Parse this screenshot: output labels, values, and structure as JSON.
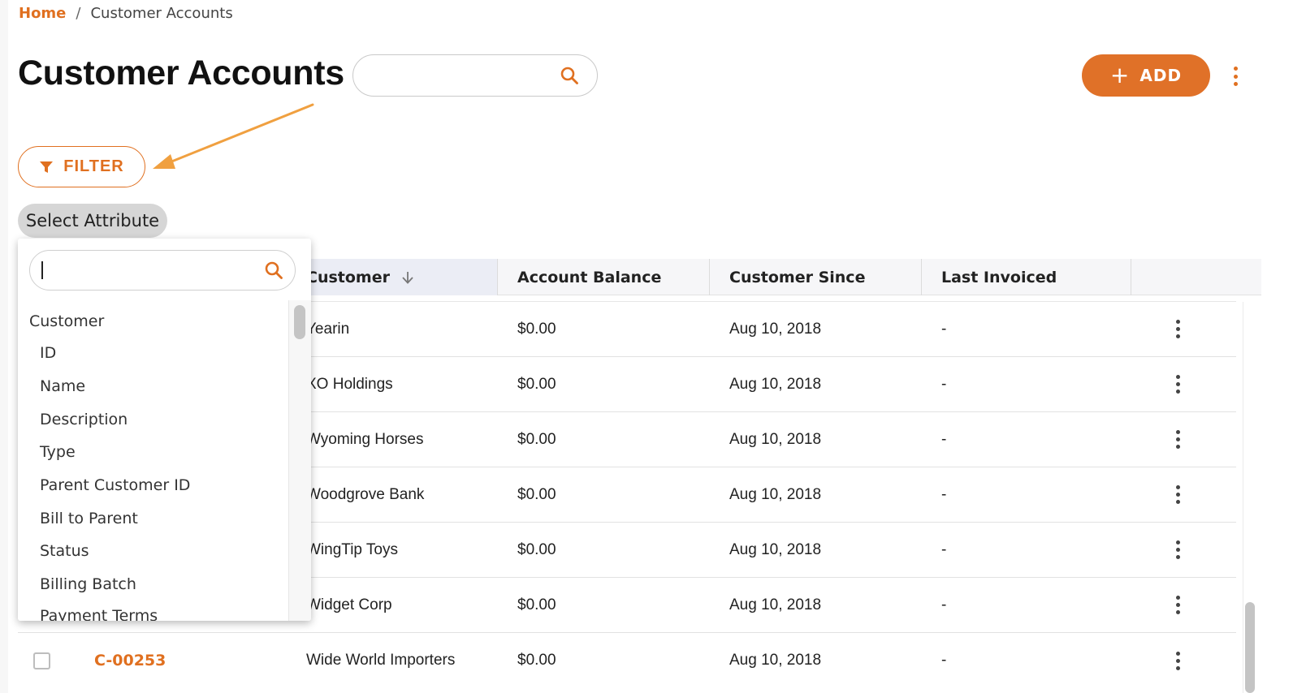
{
  "breadcrumb": {
    "home": "Home",
    "separator": "/",
    "current": "Customer Accounts"
  },
  "page": {
    "title": "Customer Accounts"
  },
  "search": {
    "placeholder": "",
    "icon": "search-icon"
  },
  "toolbar": {
    "add_icon": "+",
    "add_label": "ADD",
    "more_icon": "kebab-menu-icon"
  },
  "filter": {
    "label": "FILTER",
    "icon": "filter-funnel-icon",
    "select_attribute_label": "Select Attribute"
  },
  "colors": {
    "accent": "#e07020",
    "arrow": "#f0a040"
  },
  "table": {
    "columns": [
      "Customer",
      "Account Balance",
      "Customer Since",
      "Last Invoiced"
    ],
    "sort_column": "Customer",
    "sort_direction": "descending",
    "rows": [
      {
        "id": "",
        "name": "Yearin",
        "balance": "$0.00",
        "since": "Aug 10, 2018",
        "last_invoiced": "-"
      },
      {
        "id": "",
        "name": "XO Holdings",
        "balance": "$0.00",
        "since": "Aug 10, 2018",
        "last_invoiced": "-"
      },
      {
        "id": "",
        "name": "Wyoming Horses",
        "balance": "$0.00",
        "since": "Aug 10, 2018",
        "last_invoiced": "-"
      },
      {
        "id": "",
        "name": "Woodgrove Bank",
        "balance": "$0.00",
        "since": "Aug 10, 2018",
        "last_invoiced": "-"
      },
      {
        "id": "",
        "name": "WingTip Toys",
        "balance": "$0.00",
        "since": "Aug 10, 2018",
        "last_invoiced": "-"
      },
      {
        "id": "",
        "name": "Widget Corp",
        "balance": "$0.00",
        "since": "Aug 10, 2018",
        "last_invoiced": "-"
      },
      {
        "id": "C-00253",
        "name": "Wide World Importers",
        "balance": "$0.00",
        "since": "Aug 10, 2018",
        "last_invoiced": "-"
      }
    ]
  },
  "attribute_dropdown": {
    "search_value": "",
    "group": "Customer",
    "items": [
      "ID",
      "Name",
      "Description",
      "Type",
      "Parent Customer ID",
      "Bill to Parent",
      "Status",
      "Billing Batch",
      "Payment Terms"
    ]
  }
}
